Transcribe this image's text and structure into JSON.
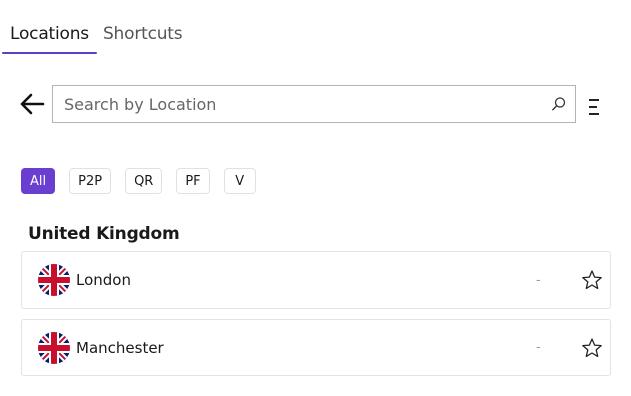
{
  "tabs": [
    {
      "label": "Locations",
      "active": true
    },
    {
      "label": "Shortcuts",
      "active": false
    }
  ],
  "search": {
    "placeholder": "Search by Location",
    "value": ""
  },
  "icons": {
    "back": "arrow-left-icon",
    "search": "search-icon",
    "menu": "menu-icon",
    "favorite": "star-outline-icon",
    "flag": "uk-flag-icon"
  },
  "filters": [
    {
      "label": "All",
      "active": true
    },
    {
      "label": "P2P",
      "active": false
    },
    {
      "label": "QR",
      "active": false
    },
    {
      "label": "PF",
      "active": false
    },
    {
      "label": "V",
      "active": false
    }
  ],
  "section": {
    "title": "United Kingdom",
    "locations": [
      {
        "name": "London",
        "status": "-"
      },
      {
        "name": "Manchester",
        "status": "-"
      }
    ]
  },
  "colors": {
    "accent": "#6a3fd0",
    "tab_underline": "#5b3fc6"
  }
}
